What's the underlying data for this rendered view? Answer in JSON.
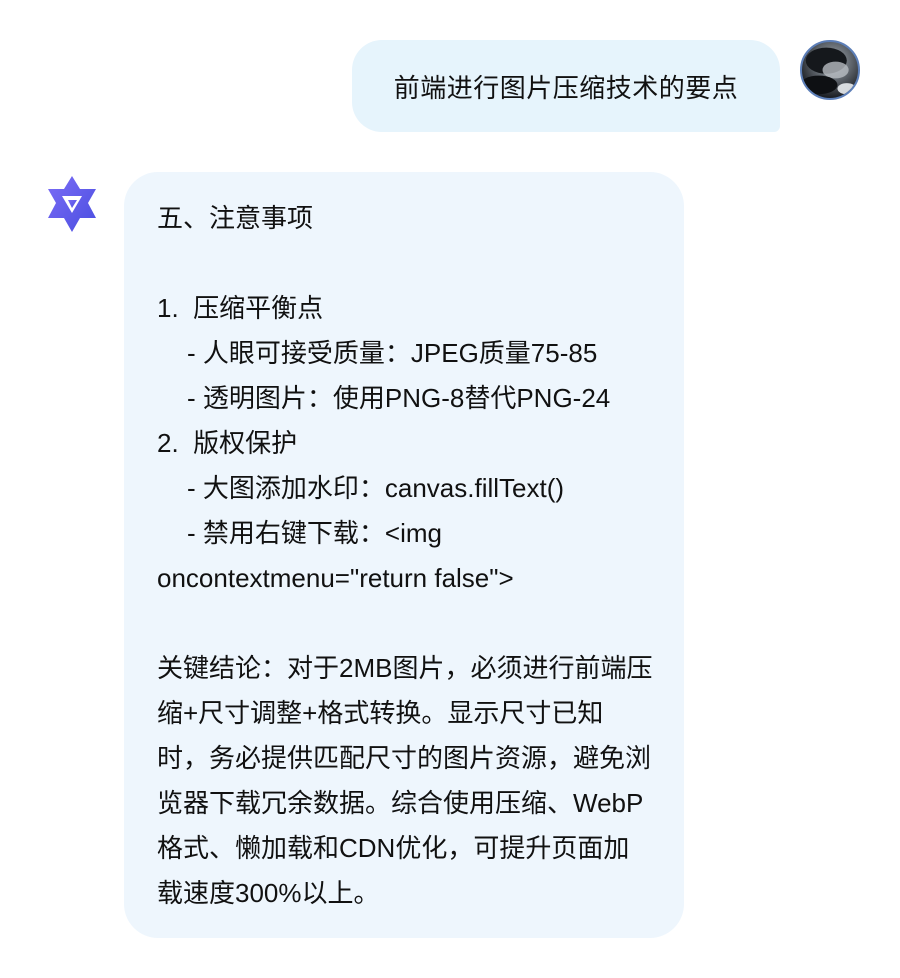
{
  "user_message": {
    "text": "前端进行图片压缩技术的要点"
  },
  "assistant_message": {
    "heading": "五、注意事项",
    "items": [
      {
        "number": "1.",
        "title": "压缩平衡点",
        "sub": [
          "- 人眼可接受质量：JPEG质量75-85",
          "- 透明图片：使用PNG-8替代PNG-24"
        ]
      },
      {
        "number": "2.",
        "title": "版权保护",
        "sub": [
          "- 大图添加水印：canvas.fillText()",
          "- 禁用右键下载：<img"
        ],
        "continuation": "oncontextmenu=\"return false\">"
      }
    ],
    "conclusion": "关键结论：对于2MB图片，必须进行前端压缩+尺寸调整+格式转换。显示尺寸已知时，务必提供匹配尺寸的图片资源，避免浏览器下载冗余数据。综合使用压缩、WebP格式、懒加载和CDN优化，可提升页面加载速度300%以上。"
  },
  "colors": {
    "user_bubble_bg": "#e6f4fc",
    "assistant_bubble_bg": "#eef6fd",
    "logo_color": "#615ced"
  },
  "icons": {
    "user_avatar": "user-avatar-photo",
    "assistant_logo": "qwen-logo-icon"
  }
}
